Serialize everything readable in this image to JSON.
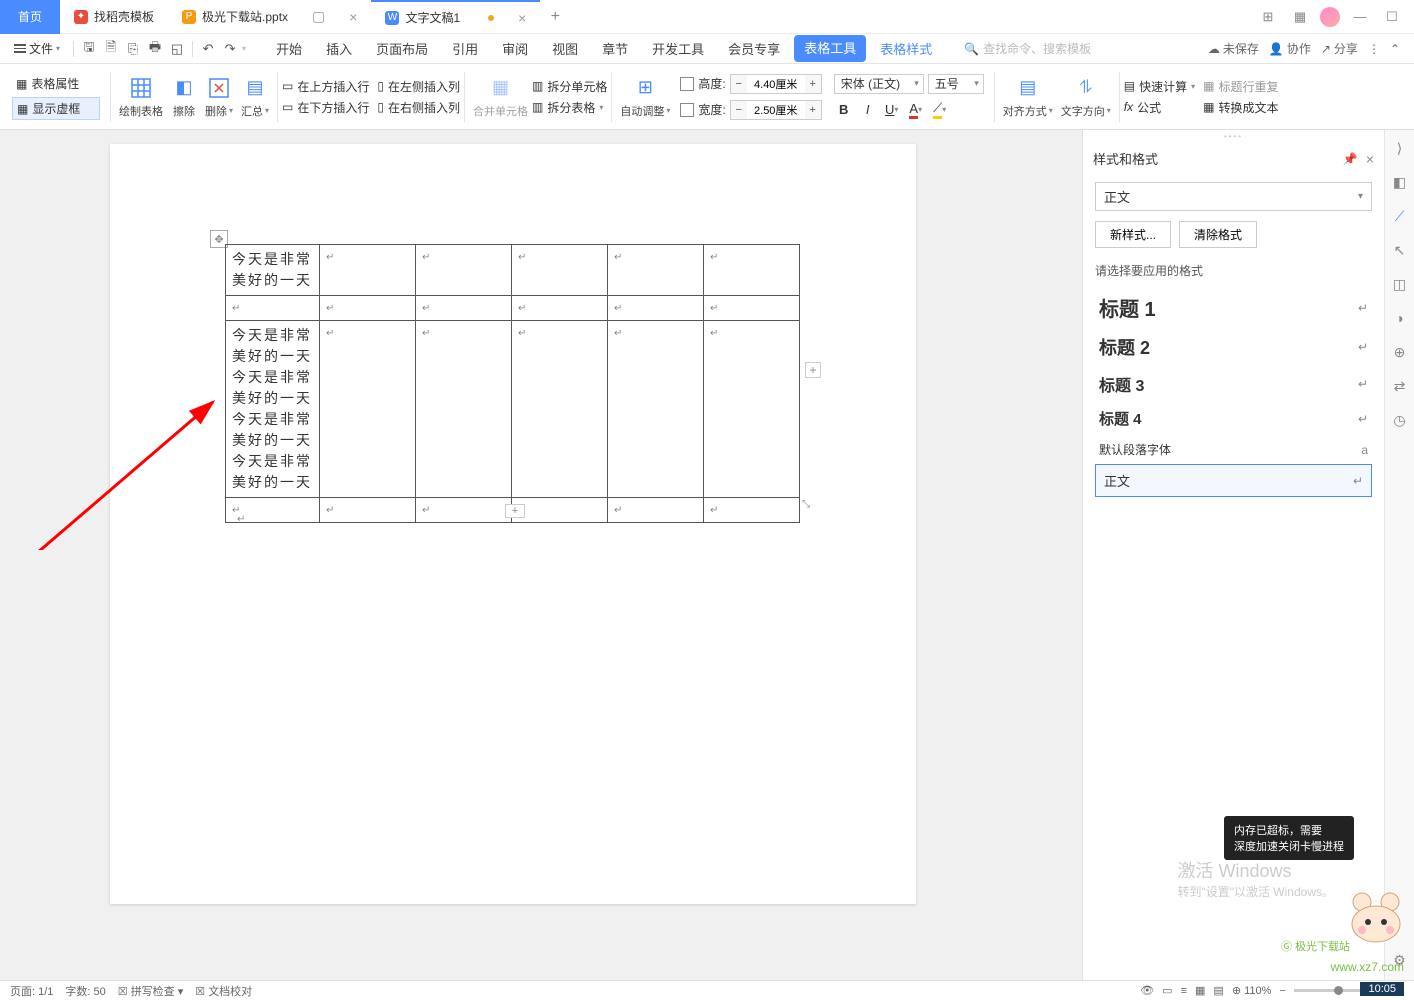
{
  "tabs": {
    "home": "首页",
    "t1": "找稻壳模板",
    "t2": "极光下载站.pptx",
    "t3": "文字文稿1"
  },
  "menu": {
    "file": "文件"
  },
  "ribbon_tabs": [
    "开始",
    "插入",
    "页面布局",
    "引用",
    "审阅",
    "视图",
    "章节",
    "开发工具",
    "会员专享"
  ],
  "ribbon_tool": "表格工具",
  "ribbon_style": "表格样式",
  "search_placeholder": "查找命令、搜索模板",
  "top_right": {
    "unsaved": "未保存",
    "coop": "协作",
    "share": "分享"
  },
  "rb": {
    "table_props": "表格属性",
    "show_frame": "显示虚框",
    "draw_table": "绘制表格",
    "eraser": "擦除",
    "delete": "删除",
    "summary": "汇总",
    "ins_row_above": "在上方插入行",
    "ins_row_below": "在下方插入行",
    "ins_col_left": "在左侧插入列",
    "ins_col_right": "在右侧插入列",
    "merge_cells": "合并单元格",
    "split_cells": "拆分单元格",
    "split_table": "拆分表格",
    "auto_adjust": "自动调整",
    "height": "高度:",
    "width": "宽度:",
    "h_val": "4.40厘米",
    "w_val": "2.50厘米",
    "font": "宋体 (正文)",
    "size": "五号",
    "align": "对齐方式",
    "text_dir": "文字方向",
    "quick_calc": "快速计算",
    "formula": "公式",
    "header_repeat": "标题行重复",
    "to_text": "转换成文本"
  },
  "table": {
    "cell1": "今天是非常\n美好的一天",
    "cell2": "今天是非常\n美好的一天\n今天是非常\n美好的一天\n今天是非常\n美好的一天\n今天是非常\n美好的一天"
  },
  "rpanel": {
    "title": "样式和格式",
    "current": "正文",
    "new_style": "新样式...",
    "clear_fmt": "清除格式",
    "hint": "请选择要应用的格式",
    "h1": "标题 1",
    "h2": "标题 2",
    "h3": "标题 3",
    "h4": "标题 4",
    "default_para": "默认段落字体",
    "body": "正文"
  },
  "status": {
    "page": "页面: 1/1",
    "words": "字数: 50",
    "spell": "拼写检查",
    "doccheck": "文档校对",
    "zoom": "110%"
  },
  "watermark": {
    "activate": "激活 Windows",
    "goto": "转到\"设置\"以激活 Windows。",
    "mem": "内存已超标，需要",
    "mem2": "深度加速关闭卡慢进程",
    "logo": "极光下载站",
    "url": "www.xz7.com",
    "time": "10:05"
  }
}
